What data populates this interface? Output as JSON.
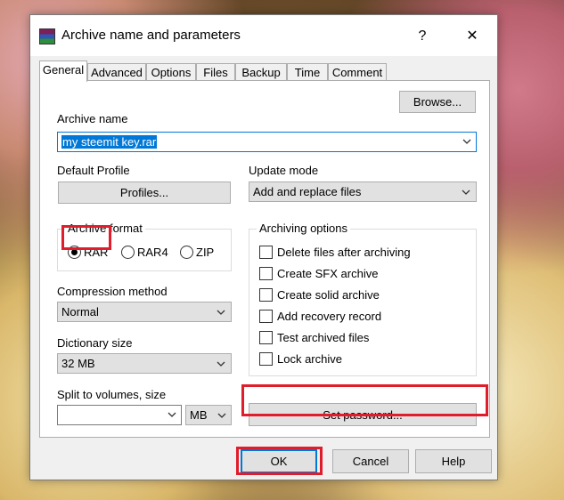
{
  "window": {
    "title": "Archive name and parameters",
    "help_glyph": "?",
    "close_glyph": "✕"
  },
  "tabs": [
    "General",
    "Advanced",
    "Options",
    "Files",
    "Backup",
    "Time",
    "Comment"
  ],
  "archive_name": {
    "label": "Archive name",
    "value": "my steemit key.rar",
    "browse": "Browse..."
  },
  "default_profile": {
    "label": "Default Profile",
    "button": "Profiles..."
  },
  "update_mode": {
    "label": "Update mode",
    "value": "Add and replace files"
  },
  "archive_format": {
    "label": "Archive format",
    "options": [
      "RAR",
      "RAR4",
      "ZIP"
    ],
    "selected": "RAR"
  },
  "compression": {
    "label": "Compression method",
    "value": "Normal"
  },
  "dictionary": {
    "label": "Dictionary size",
    "value": "32 MB"
  },
  "split": {
    "label": "Split to volumes, size",
    "value": "",
    "unit": "MB"
  },
  "archiving_options": {
    "label": "Archiving options",
    "items": [
      "Delete files after archiving",
      "Create SFX archive",
      "Create solid archive",
      "Add recovery record",
      "Test archived files",
      "Lock archive"
    ]
  },
  "set_password": "Set password...",
  "footer": {
    "ok": "OK",
    "cancel": "Cancel",
    "help": "Help"
  },
  "highlight_color": "#e01e2b"
}
